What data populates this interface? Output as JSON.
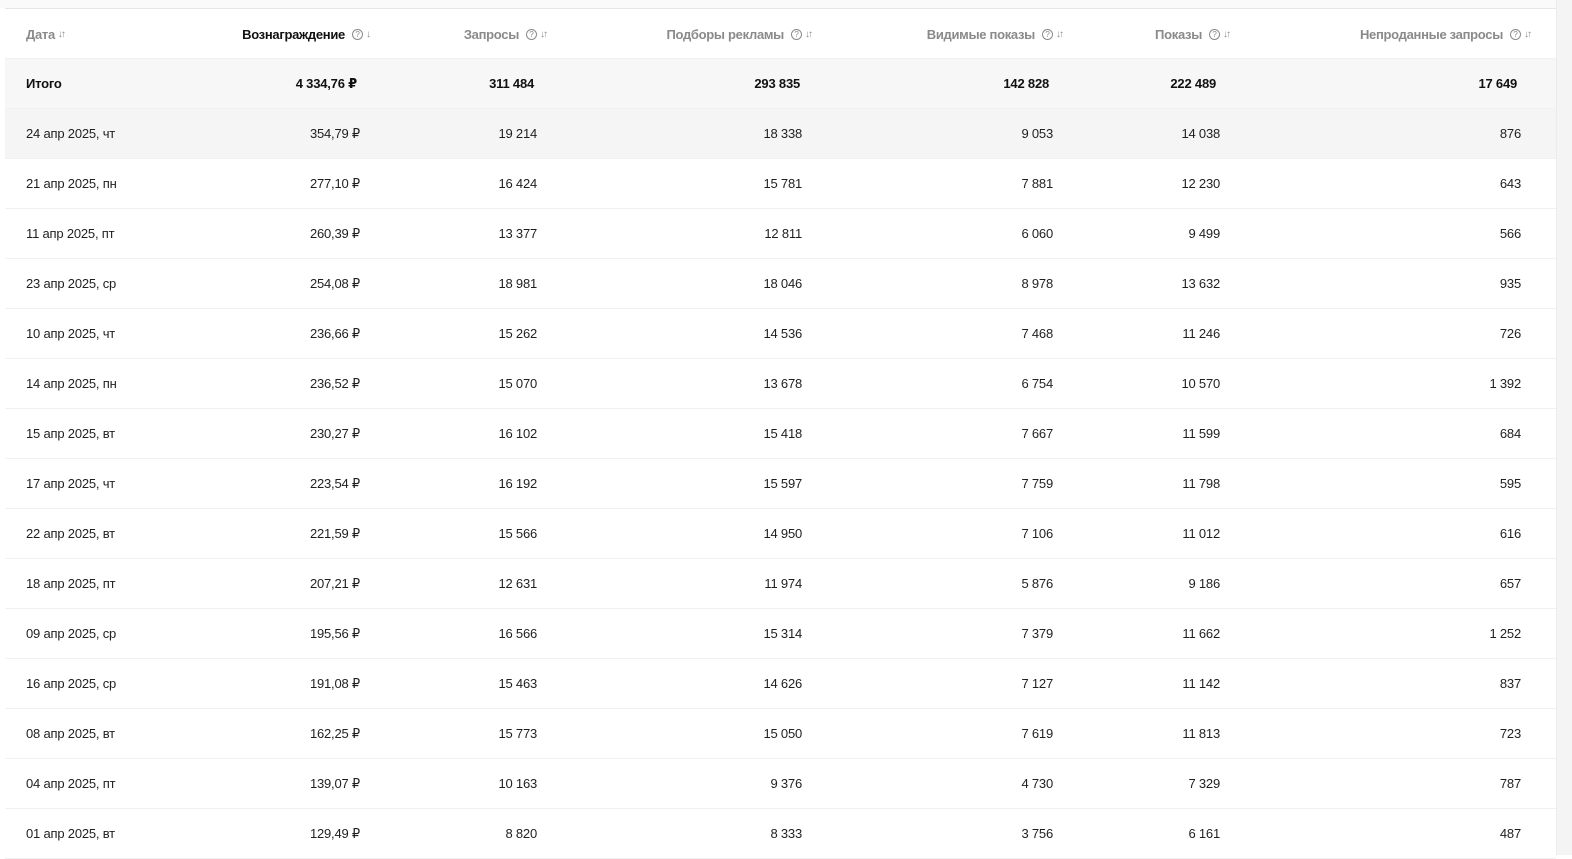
{
  "table": {
    "columns": [
      {
        "key": "date",
        "label": "Дата",
        "sort": "↓↑"
      },
      {
        "key": "reward",
        "label": "Вознаграждение",
        "sort": "↓",
        "help": "?"
      },
      {
        "key": "requests",
        "label": "Запросы",
        "sort": "↓↑",
        "help": "?"
      },
      {
        "key": "ad_matches",
        "label": "Подборы рекламы",
        "sort": "↓↑",
        "help": "?"
      },
      {
        "key": "visible_impressions",
        "label": "Видимые показы",
        "sort": "↓↑",
        "help": "?"
      },
      {
        "key": "impressions",
        "label": "Показы",
        "sort": "↓↑",
        "help": "?"
      },
      {
        "key": "unsold_requests",
        "label": "Непроданные запросы",
        "sort": "↓↑",
        "help": "?"
      }
    ],
    "total": {
      "date": "Итого",
      "reward": "4 334,76 ₽",
      "requests": "311 484",
      "ad_matches": "293 835",
      "visible_impressions": "142 828",
      "impressions": "222 489",
      "unsold_requests": "17 649"
    },
    "rows": [
      {
        "date": "24 апр 2025, чт",
        "reward": "354,79 ₽",
        "requests": "19 214",
        "ad_matches": "18 338",
        "visible_impressions": "9 053",
        "impressions": "14 038",
        "unsold_requests": "876"
      },
      {
        "date": "21 апр 2025, пн",
        "reward": "277,10 ₽",
        "requests": "16 424",
        "ad_matches": "15 781",
        "visible_impressions": "7 881",
        "impressions": "12 230",
        "unsold_requests": "643"
      },
      {
        "date": "11 апр 2025, пт",
        "reward": "260,39 ₽",
        "requests": "13 377",
        "ad_matches": "12 811",
        "visible_impressions": "6 060",
        "impressions": "9 499",
        "unsold_requests": "566"
      },
      {
        "date": "23 апр 2025, ср",
        "reward": "254,08 ₽",
        "requests": "18 981",
        "ad_matches": "18 046",
        "visible_impressions": "8 978",
        "impressions": "13 632",
        "unsold_requests": "935"
      },
      {
        "date": "10 апр 2025, чт",
        "reward": "236,66 ₽",
        "requests": "15 262",
        "ad_matches": "14 536",
        "visible_impressions": "7 468",
        "impressions": "11 246",
        "unsold_requests": "726"
      },
      {
        "date": "14 апр 2025, пн",
        "reward": "236,52 ₽",
        "requests": "15 070",
        "ad_matches": "13 678",
        "visible_impressions": "6 754",
        "impressions": "10 570",
        "unsold_requests": "1 392"
      },
      {
        "date": "15 апр 2025, вт",
        "reward": "230,27 ₽",
        "requests": "16 102",
        "ad_matches": "15 418",
        "visible_impressions": "7 667",
        "impressions": "11 599",
        "unsold_requests": "684"
      },
      {
        "date": "17 апр 2025, чт",
        "reward": "223,54 ₽",
        "requests": "16 192",
        "ad_matches": "15 597",
        "visible_impressions": "7 759",
        "impressions": "11 798",
        "unsold_requests": "595"
      },
      {
        "date": "22 апр 2025, вт",
        "reward": "221,59 ₽",
        "requests": "15 566",
        "ad_matches": "14 950",
        "visible_impressions": "7 106",
        "impressions": "11 012",
        "unsold_requests": "616"
      },
      {
        "date": "18 апр 2025, пт",
        "reward": "207,21 ₽",
        "requests": "12 631",
        "ad_matches": "11 974",
        "visible_impressions": "5 876",
        "impressions": "9 186",
        "unsold_requests": "657"
      },
      {
        "date": "09 апр 2025, ср",
        "reward": "195,56 ₽",
        "requests": "16 566",
        "ad_matches": "15 314",
        "visible_impressions": "7 379",
        "impressions": "11 662",
        "unsold_requests": "1 252"
      },
      {
        "date": "16 апр 2025, ср",
        "reward": "191,08 ₽",
        "requests": "15 463",
        "ad_matches": "14 626",
        "visible_impressions": "7 127",
        "impressions": "11 142",
        "unsold_requests": "837"
      },
      {
        "date": "08 апр 2025, вт",
        "reward": "162,25 ₽",
        "requests": "15 773",
        "ad_matches": "15 050",
        "visible_impressions": "7 619",
        "impressions": "11 813",
        "unsold_requests": "723"
      },
      {
        "date": "04 апр 2025, пт",
        "reward": "139,07 ₽",
        "requests": "10 163",
        "ad_matches": "9 376",
        "visible_impressions": "4 730",
        "impressions": "7 329",
        "unsold_requests": "787"
      },
      {
        "date": "01 апр 2025, вт",
        "reward": "129,49 ₽",
        "requests": "8 820",
        "ad_matches": "8 333",
        "visible_impressions": "3 756",
        "impressions": "6 161",
        "unsold_requests": "487"
      }
    ]
  }
}
